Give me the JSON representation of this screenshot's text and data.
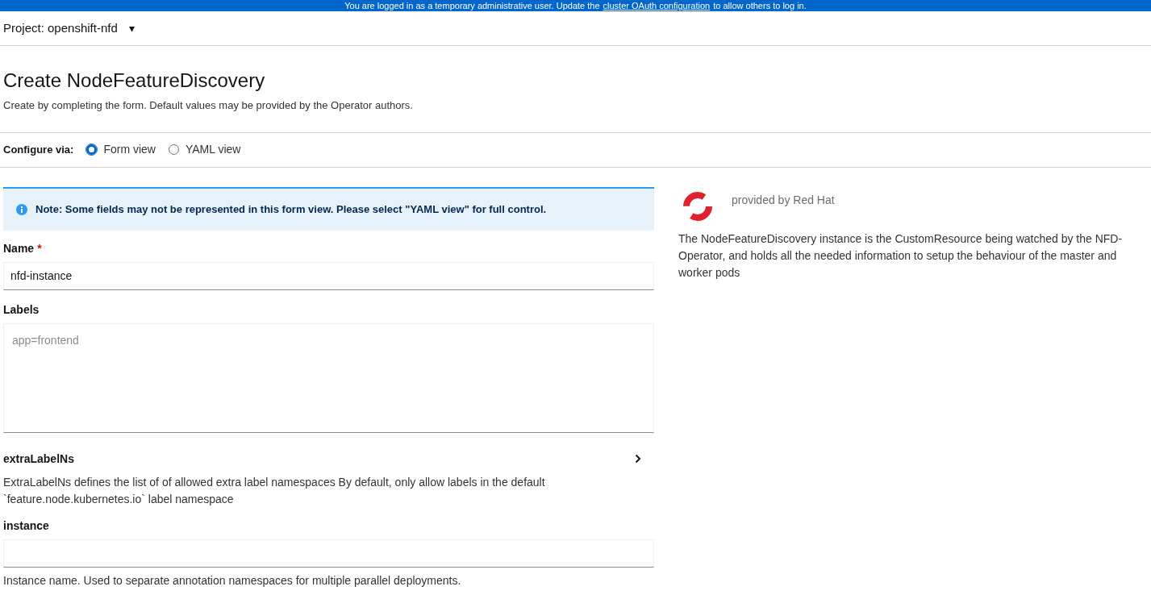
{
  "banner": {
    "before": "You are logged in as a temporary administrative user. Update the",
    "link": "cluster OAuth configuration",
    "after": "to allow others to log in."
  },
  "project": {
    "label": "Project: openshift-nfd",
    "caret": "▾"
  },
  "header": {
    "title": "Create NodeFeatureDiscovery",
    "subtitle": "Create by completing the form. Default values may be provided by the Operator authors."
  },
  "configure": {
    "label": "Configure via:",
    "options": [
      {
        "label": "Form view",
        "selected": true
      },
      {
        "label": "YAML view",
        "selected": false
      }
    ]
  },
  "alert": {
    "text": "Note: Some fields may not be represented in this form view. Please select \"YAML view\" for full control."
  },
  "fields": [
    {
      "kind": "text",
      "label": "Name",
      "required_mark": "*",
      "value": "nfd-instance"
    },
    {
      "kind": "textarea",
      "label": "Labels",
      "placeholder": "app=frontend"
    },
    {
      "kind": "expandable",
      "label": "extraLabelNs",
      "help": "ExtraLabelNs defines the list of of allowed extra label namespaces By default, only allow labels in the default `feature.node.kubernetes.io` label namespace"
    },
    {
      "kind": "text",
      "label": "instance",
      "help": "Instance name. Used to separate annotation namespaces for multiple parallel deployments."
    }
  ],
  "provider": {
    "text": "provided by Red Hat",
    "description": "The NodeFeatureDiscovery instance is the CustomResource being watched by the NFD-Operator, and holds all the needed information to setup the behaviour of the master and worker pods"
  }
}
